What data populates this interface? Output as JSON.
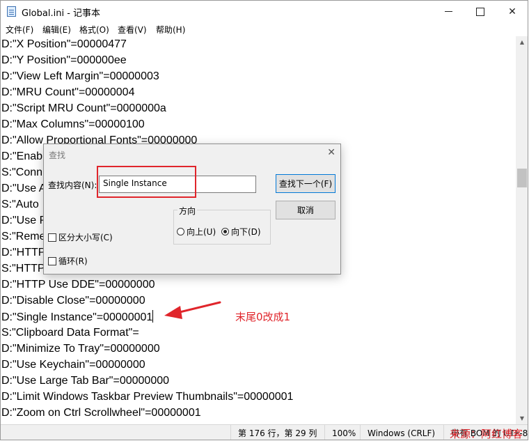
{
  "window": {
    "title": "Global.ini - 记事本",
    "minimize": "—",
    "close": "✕"
  },
  "menu": [
    "文件(F)",
    "编辑(E)",
    "格式(O)",
    "查看(V)",
    "帮助(H)"
  ],
  "lines": [
    "D:\"X Position\"=00000477",
    "D:\"Y Position\"=000000ee",
    "D:\"View Left Margin\"=00000003",
    "D:\"MRU Count\"=00000004",
    "D:\"Script MRU Count\"=0000000a",
    "D:\"Max Columns\"=00000100",
    "D:\"Allow Proportional Fonts\"=00000000",
    "D:\"Enab",
    "S:\"Conn",
    "D:\"Use A",
    "S:\"Auto",
    "D:\"Use P",
    "S:\"Reme",
    "D:\"HTTP",
    "S:\"HTTP",
    "D:\"HTTP Use DDE\"=00000000",
    "D:\"Disable Close\"=00000000",
    "D:\"Single Instance\"=00000001",
    "S:\"Clipboard Data Format\"=",
    "D:\"Minimize To Tray\"=00000000",
    "D:\"Use Keychain\"=00000000",
    "D:\"Use Large Tab Bar\"=00000000",
    "D:\"Limit Windows Taskbar Preview Thumbnails\"=00000001",
    "D:\"Zoom on Ctrl Scrollwheel\"=00000001"
  ],
  "status": {
    "position": "第 176 行，第 29 列",
    "zoom": "100%",
    "eol": "Windows (CRLF)",
    "encoding": "带有 BOM 的 UTF-8"
  },
  "find_dialog": {
    "title": "查找",
    "close": "✕",
    "label": "查找内容(N):",
    "value": "Single Instance",
    "find_next": "查找下一个(F)",
    "cancel": "取消",
    "direction": "方向",
    "up": "向上(U)",
    "down": "向下(D)",
    "match_case": "区分大小写(C)",
    "wrap": "循环(R)",
    "selected_direction": "down"
  },
  "annotation": {
    "text": "末尾0改成1",
    "color": "#e0252b"
  },
  "watermark": "来源：阿红博客"
}
